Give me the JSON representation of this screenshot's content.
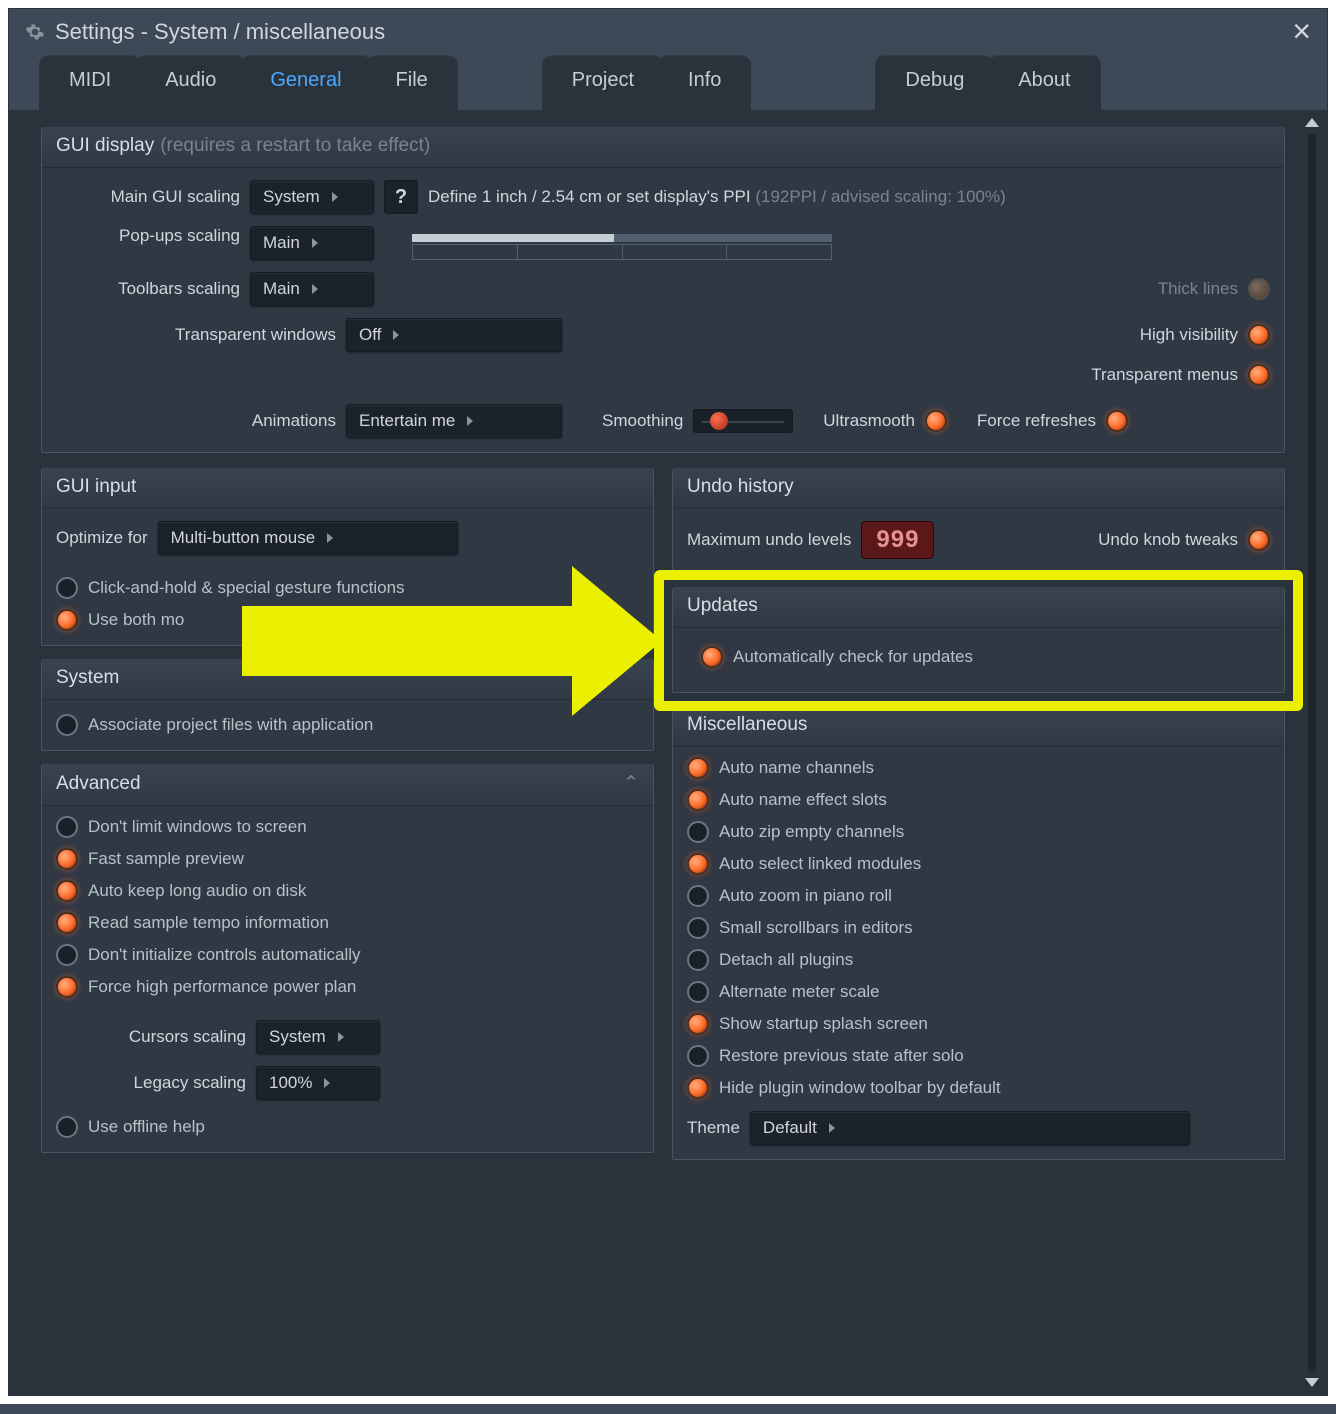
{
  "title": "Settings - System / miscellaneous",
  "tabs": [
    "MIDI",
    "Audio",
    "General",
    "File",
    "Project",
    "Info",
    "Debug",
    "About"
  ],
  "active_tab": "General",
  "gui_display": {
    "legend": "GUI display",
    "hint": "(requires a restart to take effect)",
    "main_scaling_label": "Main GUI scaling",
    "main_scaling_value": "System",
    "help_title": "?",
    "ppi_desc": "Define 1 inch / 2.54 cm or set display's PPI",
    "ppi_hint": "(192PPI / advised scaling: 100%)",
    "popups_label": "Pop-ups scaling",
    "popups_value": "Main",
    "toolbars_label": "Toolbars scaling",
    "toolbars_value": "Main",
    "transparent_windows_label": "Transparent windows",
    "transparent_windows_value": "Off",
    "animations_label": "Animations",
    "animations_value": "Entertain me",
    "smoothing_label": "Smoothing",
    "ultrasmooth": "Ultrasmooth",
    "force_refreshes": "Force refreshes",
    "thick_lines": "Thick lines",
    "high_visibility": "High visibility",
    "transparent_menus": "Transparent menus"
  },
  "gui_input": {
    "legend": "GUI input",
    "optimize_label": "Optimize for",
    "optimize_value": "Multi-button mouse",
    "click_hold": "Click-and-hold & special gesture functions",
    "use_both": "Use both mo"
  },
  "system": {
    "legend": "System",
    "associate": "Associate project files with application"
  },
  "advanced": {
    "legend": "Advanced",
    "items": [
      {
        "label": "Don't limit windows to screen",
        "on": false
      },
      {
        "label": "Fast sample preview",
        "on": true
      },
      {
        "label": "Auto keep long audio on disk",
        "on": true
      },
      {
        "label": "Read sample tempo information",
        "on": true
      },
      {
        "label": "Don't initialize controls automatically",
        "on": false
      },
      {
        "label": "Force high performance power plan",
        "on": true
      }
    ],
    "cursors_label": "Cursors scaling",
    "cursors_value": "System",
    "legacy_label": "Legacy scaling",
    "legacy_value": "100%",
    "offline_help": "Use offline help"
  },
  "undo": {
    "legend": "Undo history",
    "max_label": "Maximum undo levels",
    "max_value": "999",
    "knob_tweaks": "Undo knob tweaks"
  },
  "updates": {
    "legend": "Updates",
    "auto_check": "Automatically check for updates"
  },
  "misc": {
    "legend": "Miscellaneous",
    "items": [
      {
        "label": "Auto name channels",
        "on": true
      },
      {
        "label": "Auto name effect slots",
        "on": true
      },
      {
        "label": "Auto zip empty channels",
        "on": false
      },
      {
        "label": "Auto select linked modules",
        "on": true
      },
      {
        "label": "Auto zoom in piano roll",
        "on": false
      },
      {
        "label": "Small scrollbars in editors",
        "on": false
      },
      {
        "label": "Detach all plugins",
        "on": false
      },
      {
        "label": "Alternate meter scale",
        "on": false
      },
      {
        "label": "Show startup splash screen",
        "on": true
      },
      {
        "label": "Restore previous state after solo",
        "on": false
      },
      {
        "label": "Hide plugin window toolbar by default",
        "on": true
      }
    ],
    "theme_label": "Theme",
    "theme_value": "Default"
  }
}
